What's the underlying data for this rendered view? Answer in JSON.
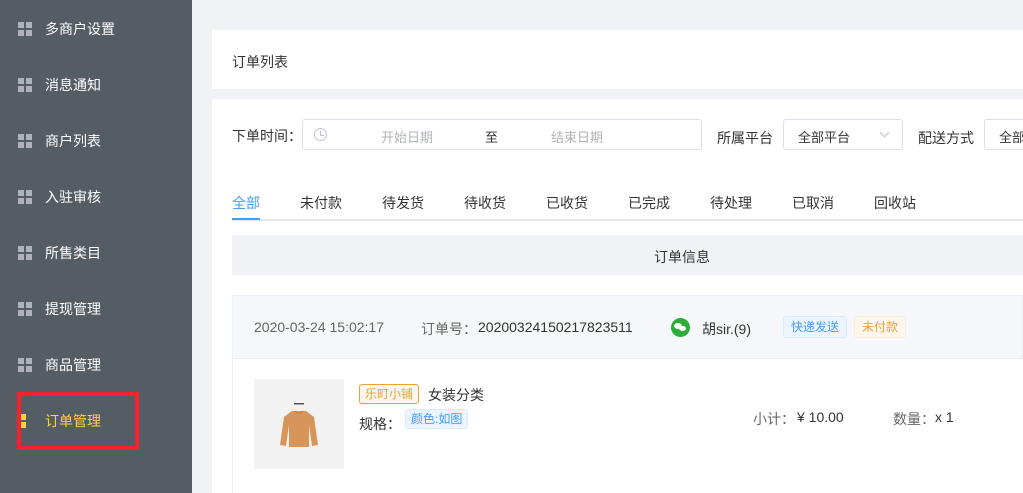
{
  "sidebar": {
    "items": [
      {
        "label": "多商户设置",
        "active": false
      },
      {
        "label": "消息通知",
        "active": false
      },
      {
        "label": "商户列表",
        "active": false
      },
      {
        "label": "入驻审核",
        "active": false
      },
      {
        "label": "所售类目",
        "active": false
      },
      {
        "label": "提现管理",
        "active": false
      },
      {
        "label": "商品管理",
        "active": false
      },
      {
        "label": "订单管理",
        "active": true
      }
    ],
    "icon": "grid-icon",
    "active_color": "#ffd04b",
    "background": "#545c64",
    "highlight_color": "#f5222d"
  },
  "header": {
    "title": "订单列表"
  },
  "filters": {
    "order_time_label": "下单时间：",
    "start_placeholder": "开始日期",
    "range_separator": "至",
    "end_placeholder": "结束日期",
    "platform_label": "所属平台",
    "platform_value": "全部平台",
    "delivery_label": "配送方式",
    "delivery_value": "全部"
  },
  "tabs": [
    {
      "label": "全部",
      "active": true
    },
    {
      "label": "未付款",
      "active": false
    },
    {
      "label": "待发货",
      "active": false
    },
    {
      "label": "待收货",
      "active": false
    },
    {
      "label": "已收货",
      "active": false
    },
    {
      "label": "已完成",
      "active": false
    },
    {
      "label": "待处理",
      "active": false
    },
    {
      "label": "已取消",
      "active": false
    },
    {
      "label": "回收站",
      "active": false
    }
  ],
  "table": {
    "header": "订单信息"
  },
  "order": {
    "time": "2020-03-24 15:02:17",
    "order_no_label": "订单号：",
    "order_no": "20200324150217823511",
    "buyer": "胡sir.(9)",
    "buyer_icon": "wechat-icon",
    "delivery_tag": "快递发送",
    "status_tag": "未付款",
    "item": {
      "shop": "乐町小铺",
      "category": "女装分类",
      "spec_label": "规格：",
      "spec_value": "颜色:如图",
      "subtotal_label": "小计：",
      "subtotal": "¥ 10.00",
      "qty_label": "数量：",
      "qty": "x 1"
    }
  },
  "colors": {
    "accent": "#409eff",
    "warning": "#e6a23c",
    "wechat": "#2bad3a"
  }
}
